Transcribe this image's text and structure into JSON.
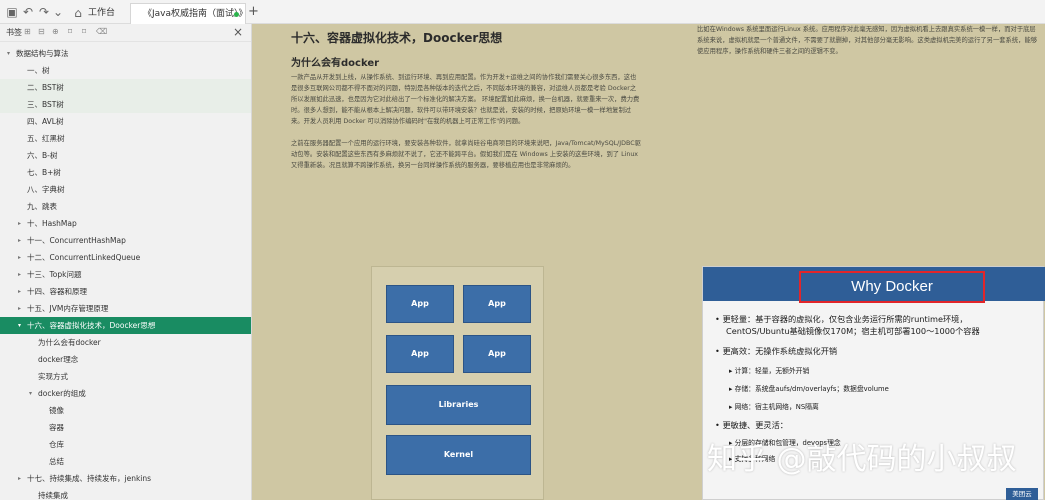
{
  "titlebar": {
    "home_tab": "工作台",
    "active_tab": "《Java权威指南（面试）》"
  },
  "sidebar": {
    "title": "书签",
    "items": [
      {
        "label": "数据结构与算法",
        "indent": 0,
        "arrow": "▾",
        "alt": false,
        "selected": false
      },
      {
        "label": "一、树",
        "indent": 1,
        "arrow": "",
        "alt": false,
        "selected": false
      },
      {
        "label": "二、BST树",
        "indent": 1,
        "arrow": "",
        "alt": true,
        "selected": false
      },
      {
        "label": "三、BST树",
        "indent": 1,
        "arrow": "",
        "alt": true,
        "selected": false
      },
      {
        "label": "四、AVL树",
        "indent": 1,
        "arrow": "",
        "alt": false,
        "selected": false
      },
      {
        "label": "五、红黑树",
        "indent": 1,
        "arrow": "",
        "alt": false,
        "selected": false
      },
      {
        "label": "六、B-树",
        "indent": 1,
        "arrow": "",
        "alt": false,
        "selected": false
      },
      {
        "label": "七、B+树",
        "indent": 1,
        "arrow": "",
        "alt": false,
        "selected": false
      },
      {
        "label": "八、字典树",
        "indent": 1,
        "arrow": "",
        "alt": false,
        "selected": false
      },
      {
        "label": "九、跳表",
        "indent": 1,
        "arrow": "",
        "alt": false,
        "selected": false
      },
      {
        "label": "十、HashMap",
        "indent": 1,
        "arrow": "▸",
        "alt": false,
        "selected": false
      },
      {
        "label": "十一、ConcurrentHashMap",
        "indent": 1,
        "arrow": "▸",
        "alt": false,
        "selected": false
      },
      {
        "label": "十二、ConcurrentLinkedQueue",
        "indent": 1,
        "arrow": "▸",
        "alt": false,
        "selected": false
      },
      {
        "label": "十三、Topk问题",
        "indent": 1,
        "arrow": "▸",
        "alt": false,
        "selected": false
      },
      {
        "label": "十四、容器和原理",
        "indent": 1,
        "arrow": "▸",
        "alt": false,
        "selected": false
      },
      {
        "label": "十五、JVM内存管理原理",
        "indent": 1,
        "arrow": "▸",
        "alt": false,
        "selected": false
      },
      {
        "label": "十六、容器虚拟化技术，Doocker思想",
        "indent": 1,
        "arrow": "▾",
        "alt": false,
        "selected": true
      },
      {
        "label": "为什么会有docker",
        "indent": 2,
        "arrow": "",
        "alt": false,
        "selected": false
      },
      {
        "label": "docker理念",
        "indent": 2,
        "arrow": "",
        "alt": false,
        "selected": false
      },
      {
        "label": "实现方式",
        "indent": 2,
        "arrow": "",
        "alt": false,
        "selected": false
      },
      {
        "label": "docker的组成",
        "indent": 2,
        "arrow": "▾",
        "alt": false,
        "selected": false
      },
      {
        "label": "镜像",
        "indent": 3,
        "arrow": "",
        "alt": false,
        "selected": false
      },
      {
        "label": "容器",
        "indent": 3,
        "arrow": "",
        "alt": false,
        "selected": false
      },
      {
        "label": "仓库",
        "indent": 3,
        "arrow": "",
        "alt": false,
        "selected": false
      },
      {
        "label": "总结",
        "indent": 3,
        "arrow": "",
        "alt": false,
        "selected": false
      },
      {
        "label": "十七、持续集成、持续发布，jenkins",
        "indent": 1,
        "arrow": "▸",
        "alt": false,
        "selected": false
      },
      {
        "label": "持续集成",
        "indent": 2,
        "arrow": "",
        "alt": false,
        "selected": false
      }
    ]
  },
  "doc": {
    "heading": "十六、容器虚拟化技术，Doocker思想",
    "subheading": "为什么会有docker",
    "para1": "一款产品从开发到上线，从操作系统、到运行环境、再到应用配置。作为开发+运维之间的协作我们需要关心很多东西，这也是很多互联网公司都不得不面对的问题，特别是各种版本的迭代之后，不同版本环境的兼容，对运维人员都是考验 Docker之所以发展如此迅速，也是因为它对此给出了一个标准化的解决方案。 环境配置如此麻烦，换一台机器，就要重来一次，费力费时。很多人想到，能不能从根本上解决问题，软件可以带环境安装？也就是说，安装的时候，把原始环境一模一样地复制过来。开发人员利用 Docker 可以消除协作编码时\"在我的机器上可正常工作\"的问题。",
    "para2": "之前在服务器配置一个应用的运行环境，要安装各种软件，就拿尚硅谷电商项目的环境来说吧，Java/Tomcat/MySQL/JDBC驱动包等。安装和配置这些东西有多麻烦就不说了，它还不能跨平台。假如我们是在 Windows 上安装的这些环境，到了 Linux 又得重新装。况且就算不跨操作系统，换另一台同样操作系统的服务器，要移植应用也是非常麻烦的。",
    "right_para": "比如在Windows 系统里面运行Linux 系统。应用程序对此毫无感知，因为虚拟机看上去跟真实系统一模一样，而对于底层系统来说，虚拟机就是一个普通文件，不需要了就删掉，对其他部分毫无影响。这类虚拟机完美的运行了另一套系统，能够使应用程序，操作系统和硬件三者之间的逻辑不变。"
  },
  "diagram": {
    "app_label": "App",
    "libraries_label": "Libraries",
    "kernel_label": "Kernel"
  },
  "slide": {
    "title": "Why Docker",
    "b1": "更轻量：基于容器的虚拟化，仅包含业务运行所需的runtime环境，",
    "b1b": "CentOS/Ubuntu基础镜像仅170M；宿主机可部署100～1000个容器",
    "b2": "更高效：无操作系统虚拟化开销",
    "s1": "计算：轻量，无额外开销",
    "s2": "存储：系统盘aufs/dm/overlayfs；数据盘volume",
    "s3": "网络：宿主机网络，NS隔离",
    "b3": "更敏捷、更灵活：",
    "s4": "分层的存储和包管理，devops理念",
    "s5": "支持多种网络",
    "badge": "美团云"
  },
  "watermark": "知乎 @敲代码的小叔叔"
}
